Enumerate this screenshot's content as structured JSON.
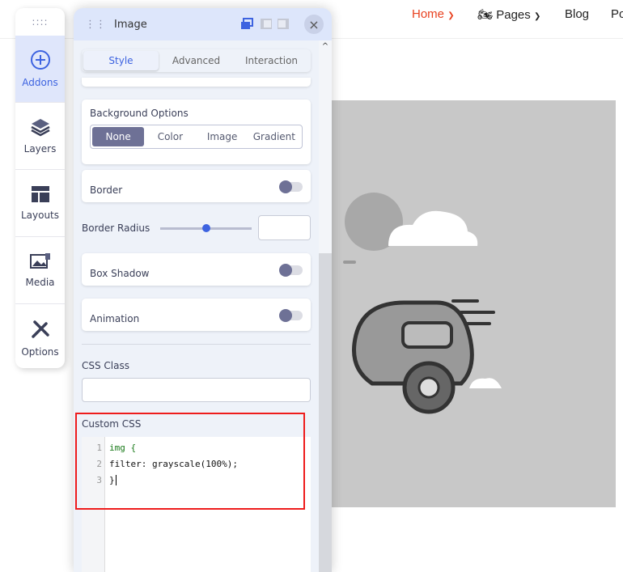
{
  "nav": {
    "items": [
      {
        "label": "Home",
        "active": true
      },
      {
        "label": "Pages",
        "icon": "motorcycle-icon"
      },
      {
        "label": "Blog"
      },
      {
        "label": "Po"
      }
    ],
    "accent": "#e8411f"
  },
  "sidebar": {
    "handle": "::::",
    "items": [
      {
        "label": "Addons",
        "icon": "plus-circle-icon",
        "active": true
      },
      {
        "label": "Layers",
        "icon": "layers-icon"
      },
      {
        "label": "Layouts",
        "icon": "layout-icon"
      },
      {
        "label": "Media",
        "icon": "media-icon"
      },
      {
        "label": "Options",
        "icon": "tools-icon"
      }
    ]
  },
  "panel": {
    "title": "Image",
    "close": "×",
    "tabs": [
      "Style",
      "Advanced",
      "Interaction"
    ],
    "active_tab": "Style",
    "background_options": {
      "label": "Background Options",
      "options": [
        "None",
        "Color",
        "Image",
        "Gradient"
      ],
      "selected": "None"
    },
    "border": {
      "label": "Border",
      "enabled": false
    },
    "border_radius": {
      "label": "Border Radius",
      "value": "",
      "slider": 0.5
    },
    "box_shadow": {
      "label": "Box Shadow",
      "enabled": false
    },
    "animation": {
      "label": "Animation",
      "enabled": false
    },
    "css_class": {
      "label": "CSS Class",
      "value": ""
    },
    "custom_css": {
      "label": "Custom CSS",
      "lines": [
        {
          "n": "1",
          "code": "img {"
        },
        {
          "n": "2",
          "code": "filter: grayscale(100%);"
        },
        {
          "n": "3",
          "code": "}"
        }
      ]
    }
  },
  "colors": {
    "active_bg": "#dfe6fb",
    "accent_blue": "#3d63e0",
    "highlight": "#ee1c1c"
  }
}
